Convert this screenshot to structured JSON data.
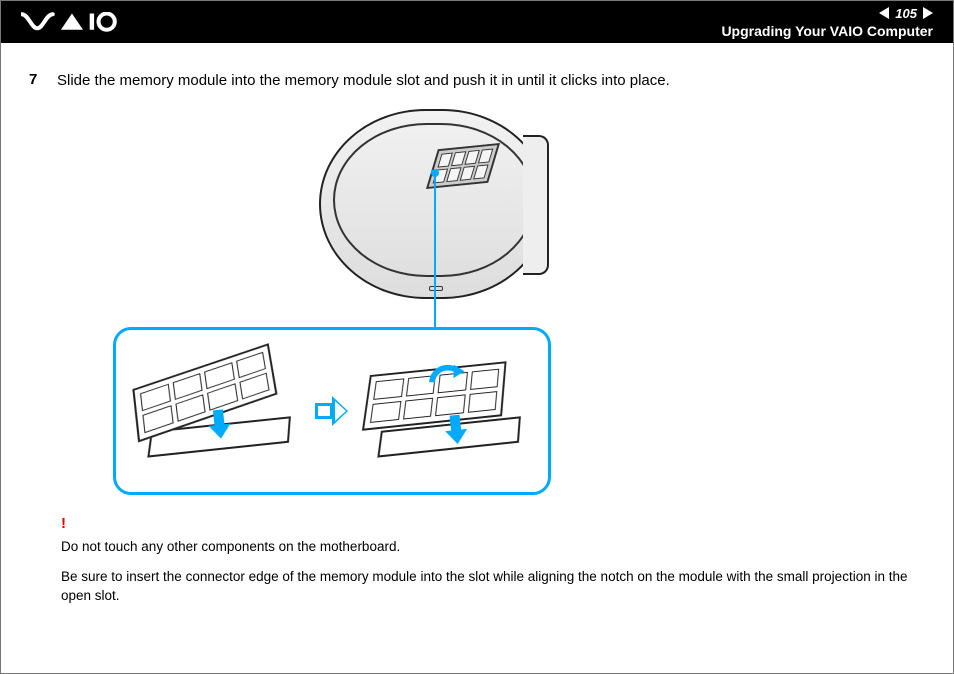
{
  "header": {
    "logo_name": "VAIO",
    "page_number": "105",
    "section_title": "Upgrading Your VAIO Computer"
  },
  "step": {
    "number": "7",
    "text": "Slide the memory module into the memory module slot and push it in until it clicks into place."
  },
  "warning": {
    "mark": "!",
    "line1": "Do not touch any other components on the motherboard.",
    "line2": "Be sure to insert the connector edge of the memory module into the slot while aligning the notch on the module with the small projection in the open slot."
  },
  "icons": {
    "prev": "nav-prev-icon",
    "next": "nav-next-icon",
    "step_arrow": "step-forward-icon",
    "press_down": "press-down-icon",
    "rotate": "rotate-down-icon"
  }
}
